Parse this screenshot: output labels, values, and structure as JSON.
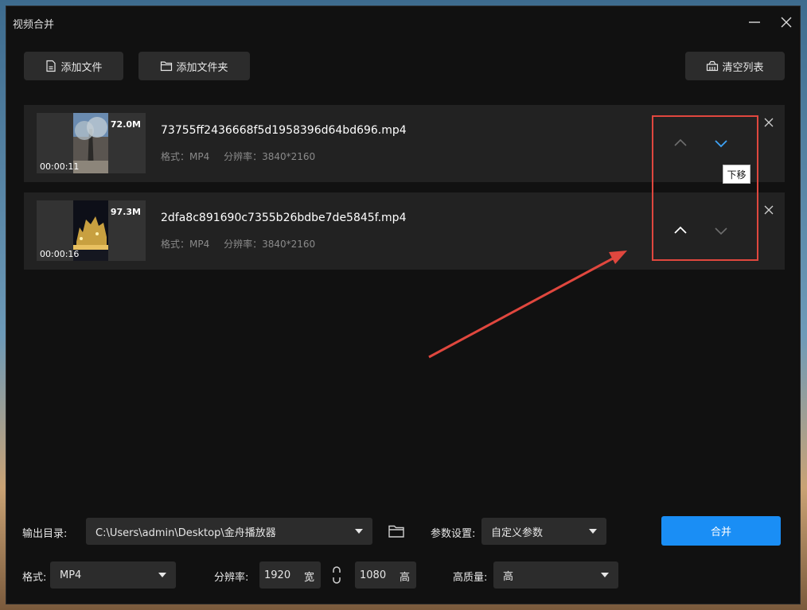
{
  "window": {
    "title": "视频合并"
  },
  "toolbar": {
    "add_file_label": "添加文件",
    "add_folder_label": "添加文件夹",
    "clear_list_label": "清空列表"
  },
  "files": [
    {
      "size": "72.0M",
      "duration": "00:00:11",
      "name": "73755ff2436668f5d1958396d64bd696.mp4",
      "format_label": "格式：MP4",
      "resolution_label": "分辨率：3840*2160"
    },
    {
      "size": "97.3M",
      "duration": "00:00:16",
      "name": "2dfa8c891690c7355b26bdbe7de5845f.mp4",
      "format_label": "格式：MP4",
      "resolution_label": "分辨率：3840*2160"
    }
  ],
  "tooltip": {
    "move_down": "下移"
  },
  "settings": {
    "output_dir_label": "输出目录:",
    "output_dir_value": "C:\\Users\\admin\\Desktop\\金舟播放器",
    "param_label": "参数设置:",
    "param_value": "自定义参数",
    "merge_label": "合并",
    "format_label": "格式:",
    "format_value": "MP4",
    "resolution_label": "分辨率:",
    "width_value": "1920",
    "width_unit": "宽",
    "height_value": "1080",
    "height_unit": "高",
    "quality_label": "高质量:",
    "quality_value": "高"
  },
  "colors": {
    "accent": "#1a8ef5",
    "annotation": "#e0473e",
    "active_arrow": "#3fa3f7"
  }
}
